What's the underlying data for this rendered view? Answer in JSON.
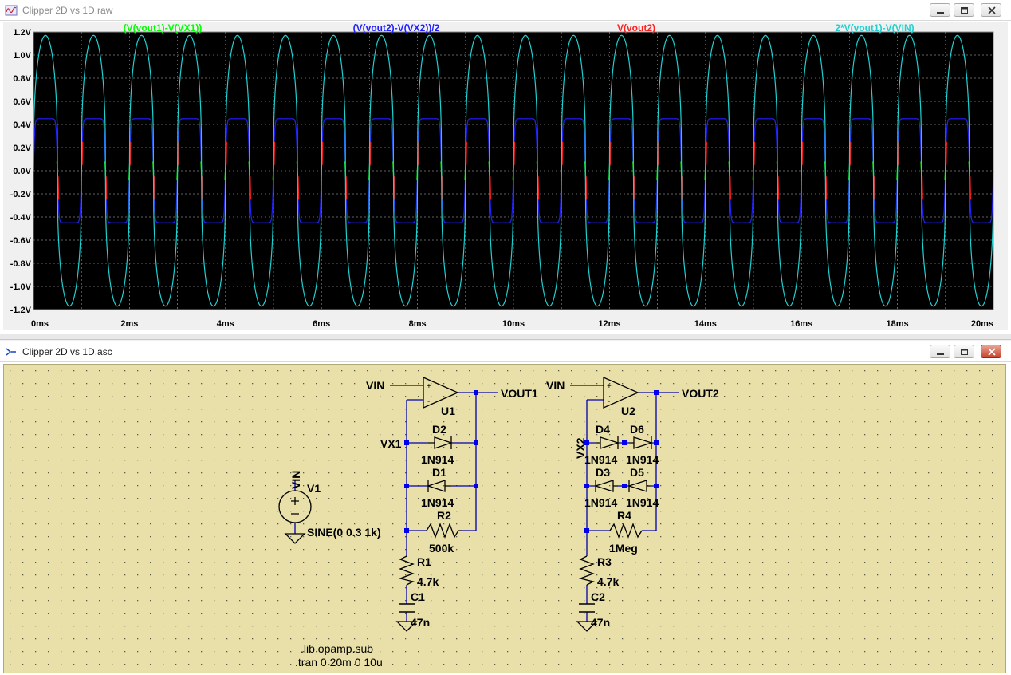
{
  "plot_window": {
    "title": "Clipper 2D vs 1D.raw",
    "traces": [
      {
        "name": "(V(vout1)-V(VX1))",
        "color": "#00ff00"
      },
      {
        "name": "(V(vout2)-V(VX2))/2",
        "color": "#2020ff"
      },
      {
        "name": "V(vout2)",
        "color": "#ff2020"
      },
      {
        "name": "2*V(vout1)-V(VIN)",
        "color": "#20d0d0"
      }
    ],
    "y_ticks": [
      "1.2V",
      "1.0V",
      "0.8V",
      "0.6V",
      "0.4V",
      "0.2V",
      "0.0V",
      "-0.2V",
      "-0.4V",
      "-0.6V",
      "-0.8V",
      "-1.0V",
      "-1.2V"
    ],
    "x_ticks": [
      "0ms",
      "2ms",
      "4ms",
      "6ms",
      "8ms",
      "10ms",
      "12ms",
      "14ms",
      "16ms",
      "18ms",
      "20ms"
    ]
  },
  "chart_data": {
    "type": "line",
    "x_unit": "ms",
    "y_unit": "V",
    "xlim": [
      0,
      20
    ],
    "ylim": [
      -1.2,
      1.2
    ],
    "grid": true,
    "series": [
      {
        "name": "2*V(vout1)-V(VIN)",
        "color": "#20d0d0",
        "shape": "clipped-sine",
        "frequency_khz": 1,
        "peak": 1.17
      },
      {
        "name": "(V(vout2)-V(VX2))/2",
        "color": "#2020ff",
        "shape": "square-like",
        "frequency_khz": 1,
        "peak": 0.45
      },
      {
        "name": "(V(vout1)-V(VX1))",
        "color": "#00ff00",
        "shape": "transition-spikes",
        "frequency_khz": 1
      },
      {
        "name": "V(vout2)",
        "color": "#ff2020",
        "shape": "transition-spikes",
        "frequency_khz": 1
      }
    ]
  },
  "schematic_window": {
    "title": "Clipper 2D vs 1D.asc",
    "labels": {
      "vin1": "VIN",
      "vin2": "VIN",
      "vin_src": "VIN",
      "vout1": "VOUT1",
      "vout2": "VOUT2",
      "u1": "U1",
      "u2": "U2",
      "vx1": "VX1",
      "vx2": "VX2",
      "d1": "D1",
      "d2": "D2",
      "d3": "D3",
      "d4": "D4",
      "d5": "D5",
      "d6": "D6",
      "d2_model": "1N914",
      "d1_model": "1N914",
      "d4_model": "1N914",
      "d6_model": "1N914",
      "d3_model": "1N914",
      "d5_model": "1N914",
      "r1": "R1",
      "r1_val": "4.7k",
      "r2": "R2",
      "r2_val": "500k",
      "r3": "R3",
      "r3_val": "4.7k",
      "r4": "R4",
      "r4_val": "1Meg",
      "c1": "C1",
      "c1_val": "47n",
      "c2": "C2",
      "c2_val": "47n",
      "v1": "V1",
      "v1_val": "SINE(0 0.3 1k)",
      "plus": "+",
      "minus": "-",
      "lib": ".lib opamp.sub",
      "tran": ".tran 0 20m 0 10u"
    }
  }
}
